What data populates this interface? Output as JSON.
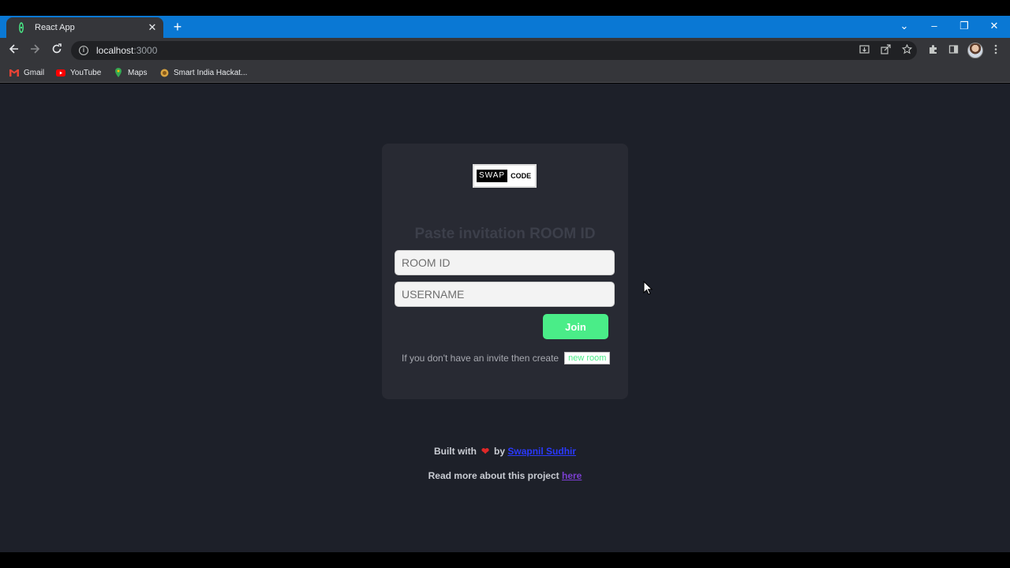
{
  "browser": {
    "tab": {
      "title": "React App",
      "close": "✕"
    },
    "new_tab": "+",
    "window_controls": {
      "dropdown": "⌄",
      "minimize": "–",
      "restore": "❐",
      "close": "✕"
    },
    "address": {
      "host": "localhost",
      "port": ":3000"
    },
    "bookmarks": [
      {
        "label": "Gmail",
        "icon": "gmail-icon"
      },
      {
        "label": "YouTube",
        "icon": "youtube-icon"
      },
      {
        "label": "Maps",
        "icon": "maps-icon"
      },
      {
        "label": "Smart India Hackat...",
        "icon": "sih-icon"
      }
    ]
  },
  "page": {
    "logo": {
      "swap": "SWAP",
      "code": "CODE"
    },
    "heading": "Paste invitation ROOM ID",
    "room_placeholder": "ROOM ID",
    "username_placeholder": "USERNAME",
    "join_label": "Join",
    "invite_text": "If you don't have an invite then create",
    "new_room_label": "new room",
    "footer": {
      "built_with": "Built with",
      "by": "by",
      "author": "Swapnil Sudhir",
      "read_more": "Read more about this project",
      "here": "here"
    }
  },
  "colors": {
    "accent": "#4aed88",
    "background": "#1d2029",
    "card": "#282a33"
  }
}
